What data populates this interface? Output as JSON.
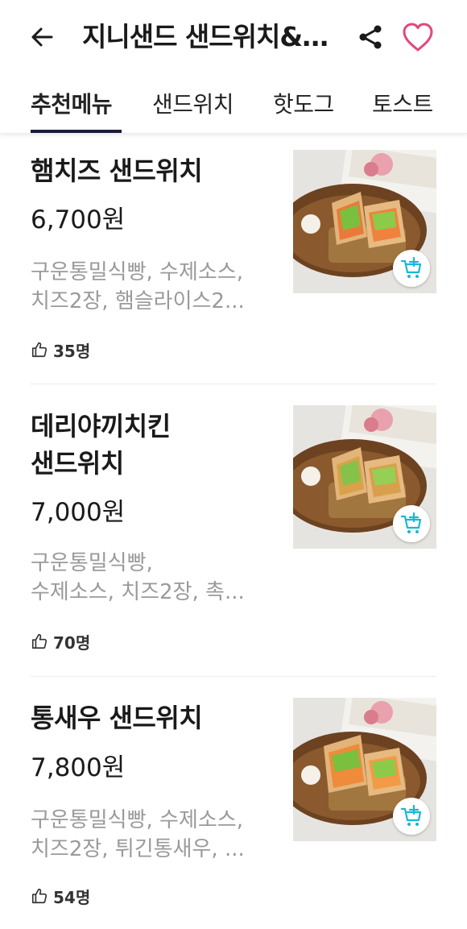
{
  "header": {
    "title": "지니샌드 샌드위치&토스트",
    "back_icon": "arrow-left-icon",
    "share_icon": "share-icon",
    "favorite_icon": "heart-outline-icon",
    "accent_color": "#e4477a"
  },
  "tabs": [
    {
      "label": "추천메뉴",
      "active": true
    },
    {
      "label": "샌드위치",
      "active": false
    },
    {
      "label": "핫도그",
      "active": false
    },
    {
      "label": "토스트",
      "active": false
    }
  ],
  "menu": [
    {
      "name_lines": [
        "햄치즈 샌드위치"
      ],
      "price": "6,700원",
      "desc_lines": [
        "구운통밀식빵, 수제소스,",
        "치즈2장, 햄슬라이스2..."
      ],
      "likes": "35명"
    },
    {
      "name_lines": [
        "데리야끼치킨",
        "샌드위치"
      ],
      "price": "7,000원",
      "desc_lines": [
        "구운통밀식빵,",
        "수제소스, 치즈2장, 촉..."
      ],
      "likes": "70명"
    },
    {
      "name_lines": [
        "통새우 샌드위치"
      ],
      "price": "7,800원",
      "desc_lines": [
        "구운통밀식빵, 수제소스,",
        "치즈2장, 튀긴통새우, ..."
      ],
      "likes": "54명"
    }
  ],
  "icons": {
    "like": "thumbs-up-icon",
    "cart": "cart-add-icon"
  },
  "colors": {
    "cart_icon": "#1ab6d8",
    "desc_text": "#9a9a9a",
    "tab_underline": "#1c1c3a"
  }
}
